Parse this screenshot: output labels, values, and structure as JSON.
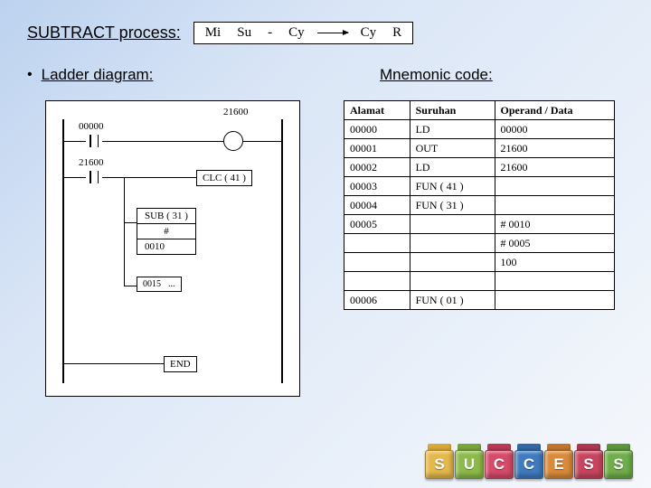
{
  "title": "SUBTRACT process:",
  "equation": {
    "a": "Mi",
    "b": "Su",
    "minus": "-",
    "c": "Cy",
    "d": "Cy",
    "e": "R"
  },
  "sections": {
    "ladder": "Ladder diagram:",
    "mnemonic": "Mnemonic code:"
  },
  "ladder": {
    "lbl_00000": "00000",
    "lbl_21600_top": "21600",
    "lbl_21600_left": "21600",
    "clc": "CLC ( 41 )",
    "sub": "SUB ( 31 )",
    "hash": "#",
    "v0010": "0010",
    "v0015": "0015",
    "dots": "...",
    "end": "END"
  },
  "table": {
    "headers": {
      "a": "Alamat",
      "b": "Suruhan",
      "c": "Operand / Data"
    },
    "rows": [
      {
        "a": "00000",
        "b": "LD",
        "c": "00000"
      },
      {
        "a": "00001",
        "b": "OUT",
        "c": "21600"
      },
      {
        "a": "00002",
        "b": "LD",
        "c": "21600"
      },
      {
        "a": "00003",
        "b": "FUN ( 41 )",
        "c": ""
      },
      {
        "a": "00004",
        "b": "FUN ( 31 )",
        "c": ""
      },
      {
        "a": "00005",
        "b": "",
        "c": "# 0010"
      },
      {
        "a": "",
        "b": "",
        "c": "# 0005"
      },
      {
        "a": "",
        "b": "",
        "c": "100"
      },
      {
        "a": "",
        "b": "",
        "c": ""
      },
      {
        "a": "00006",
        "b": "FUN ( 01 )",
        "c": ""
      }
    ]
  },
  "blocks": [
    {
      "letter": "S",
      "color": "#e5b84a",
      "top": "#d9a836"
    },
    {
      "letter": "U",
      "color": "#8dbb4a",
      "top": "#79a53a"
    },
    {
      "letter": "C",
      "color": "#d64a6a",
      "top": "#b83a57"
    },
    {
      "letter": "C",
      "color": "#3f7bbf",
      "top": "#3268a5"
    },
    {
      "letter": "E",
      "color": "#d98a3a",
      "top": "#c0762c"
    },
    {
      "letter": "S",
      "color": "#c9455f",
      "top": "#ad374e"
    },
    {
      "letter": "S",
      "color": "#6fae4a",
      "top": "#5c963b"
    }
  ]
}
